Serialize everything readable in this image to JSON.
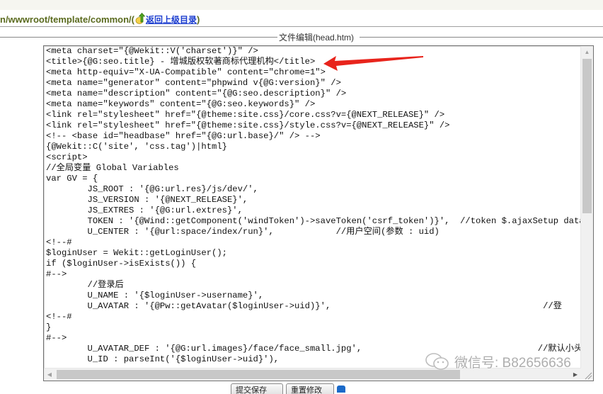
{
  "path_bar": {
    "path": "n/wwwroot/template/common/",
    "open_paren": "(",
    "up_link_label": "返回上级目录",
    "close_paren": ")"
  },
  "editor": {
    "legend": "文件编辑(head.htm)",
    "lines": [
      "<meta charset=\"{@Wekit::V('charset')}\" />",
      "<title>{@G:seo.title} - 增城版权软著商标代理机构</title>",
      "<meta http-equiv=\"X-UA-Compatible\" content=\"chrome=1\">",
      "<meta name=\"generator\" content=\"phpwind v{@G:version}\" />",
      "<meta name=\"description\" content=\"{@G:seo.description}\" />",
      "<meta name=\"keywords\" content=\"{@G:seo.keywords}\" />",
      "<link rel=\"stylesheet\" href=\"{@theme:site.css}/core.css?v={@NEXT_RELEASE}\" />",
      "<link rel=\"stylesheet\" href=\"{@theme:site.css}/style.css?v={@NEXT_RELEASE}\" />",
      "<!-- <base id=\"headbase\" href=\"{@G:url.base}/\" /> -->",
      "{@Wekit::C('site', 'css.tag')|html}",
      "<script>",
      "//全局变量 Global Variables",
      "var GV = {",
      "        JS_ROOT : '{@G:url.res}/js/dev/',",
      "        JS_VERSION : '{@NEXT_RELEASE}',",
      "        JS_EXTRES : '{@G:url.extres}',",
      "        TOKEN : '{@Wind::getComponent('windToken')->saveToken('csrf_token')}',  //token $.ajaxSetup data",
      "        U_CENTER : '{@url:space/index/run}',            //用户空间(参数 : uid)",
      "<!--#",
      "$loginUser = Wekit::getLoginUser();",
      "if ($loginUser->isExists()) {",
      "#-->",
      "        //登录后",
      "        U_NAME : '{$loginUser->username}',",
      "        U_AVATAR : '{@Pw::getAvatar($loginUser->uid)}',                                         //登",
      "<!--#",
      "}",
      "#-->",
      "        U_AVATAR_DEF : '{@G:url.images}/face/face_small.jpg',                                  //默认小头像",
      "        U_ID : parseInt('{$loginUser->uid}'),"
    ]
  },
  "buttons": {
    "save_label": "提交保存",
    "reset_label": "重置修改"
  },
  "watermark": {
    "text": "微信号: B82656636"
  },
  "colors": {
    "path_text": "#5a6a1e",
    "link": "#1a3ccf",
    "annotation_arrow": "#e8241c"
  }
}
